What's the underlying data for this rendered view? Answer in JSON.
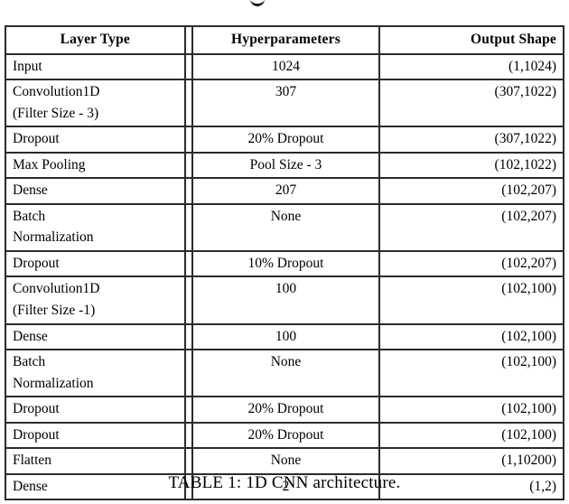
{
  "table": {
    "columns": [
      {
        "key": "layer_type",
        "label": "Layer Type",
        "align": "left"
      },
      {
        "key": "hyperparameters",
        "label": "Hyperparameters",
        "align": "center"
      },
      {
        "key": "output_shape",
        "label": "Output Shape",
        "align": "right"
      }
    ],
    "rows": [
      {
        "layer_type": "Input",
        "layer_type_line2": "",
        "hyperparameters": "1024",
        "output_shape": "(1,1024)"
      },
      {
        "layer_type": "Convolution1D",
        "layer_type_line2": "(Filter Size - 3)",
        "hyperparameters": "307",
        "output_shape": "(307,1022)"
      },
      {
        "layer_type": "Dropout",
        "layer_type_line2": "",
        "hyperparameters": "20% Dropout",
        "output_shape": "(307,1022)"
      },
      {
        "layer_type": "Max Pooling",
        "layer_type_line2": "",
        "hyperparameters": "Pool Size - 3",
        "output_shape": "(102,1022)"
      },
      {
        "layer_type": "Dense",
        "layer_type_line2": "",
        "hyperparameters": "207",
        "output_shape": "(102,207)"
      },
      {
        "layer_type": "Batch",
        "layer_type_line2": "Normalization",
        "hyperparameters": "None",
        "output_shape": "(102,207)"
      },
      {
        "layer_type": "Dropout",
        "layer_type_line2": "",
        "hyperparameters": "10% Dropout",
        "output_shape": "(102,207)"
      },
      {
        "layer_type": "Convolution1D",
        "layer_type_line2": "(Filter Size -1)",
        "hyperparameters": "100",
        "output_shape": "(102,100)"
      },
      {
        "layer_type": "Dense",
        "layer_type_line2": "",
        "hyperparameters": "100",
        "output_shape": "(102,100)"
      },
      {
        "layer_type": "Batch",
        "layer_type_line2": "Normalization",
        "hyperparameters": "None",
        "output_shape": "(102,100)"
      },
      {
        "layer_type": "Dropout",
        "layer_type_line2": "",
        "hyperparameters": "20% Dropout",
        "output_shape": "(102,100)"
      },
      {
        "layer_type": "Dropout",
        "layer_type_line2": "",
        "hyperparameters": "20% Dropout",
        "output_shape": "(102,100)"
      },
      {
        "layer_type": "Flatten",
        "layer_type_line2": "",
        "hyperparameters": "None",
        "output_shape": "(1,10200)"
      },
      {
        "layer_type": "Dense",
        "layer_type_line2": "",
        "hyperparameters": "2",
        "output_shape": "(1,2)"
      }
    ]
  },
  "caption": {
    "text": "TABLE 1: 1D CNN architecture."
  },
  "colors": {
    "rule": "#2b2b2b",
    "text": "#000000",
    "background": "#ffffff"
  }
}
